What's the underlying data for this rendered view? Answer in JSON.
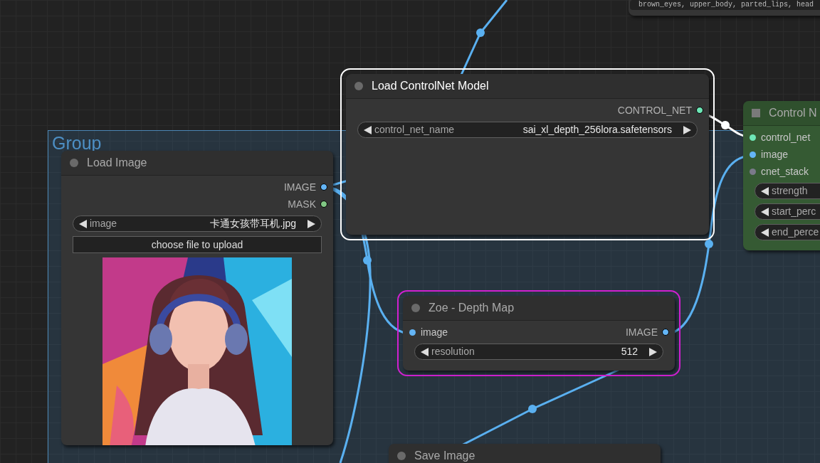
{
  "canvas": {
    "groups": [
      {
        "title": "Group"
      }
    ],
    "nodes": [
      {
        "kind": "note",
        "selected": false,
        "running": false,
        "color": "#353535",
        "widgets": [
          {
            "kind": "text",
            "value": "brown_eyes, upper_body, parted_lips, head"
          }
        ]
      },
      {
        "title": "Load Image",
        "kind": "standard",
        "selected": false,
        "running": false,
        "color": "#353535",
        "outputs": [
          {
            "label": "IMAGE",
            "color": "#64b5f6"
          },
          {
            "label": "MASK",
            "color": "#81c784"
          }
        ],
        "widgets": [
          {
            "kind": "combo",
            "label": "image",
            "value": "卡通女孩带耳机.jpg"
          },
          {
            "kind": "button",
            "label": "choose file to upload"
          },
          {
            "kind": "picture"
          }
        ]
      },
      {
        "title": "Load ControlNet Model",
        "kind": "standard",
        "selected": true,
        "running": false,
        "color": "#353535",
        "outputs": [
          {
            "label": "CONTROL_NET",
            "color": "#6ee7b7"
          }
        ],
        "widgets": [
          {
            "kind": "combo",
            "label": "control_net_name",
            "value": "sai_xl_depth_256lora.safetensors"
          }
        ]
      },
      {
        "title": "Control N",
        "kind": "custom",
        "selected": false,
        "running": false,
        "color": "#355a33",
        "inputs": [
          {
            "label": "control_net",
            "color": "#6ee7b7"
          },
          {
            "label": "image",
            "color": "#64b5f6"
          },
          {
            "label": "cnet_stack",
            "color": "#7a7a8a"
          }
        ],
        "widgets": [
          {
            "kind": "combo",
            "label": "strength"
          },
          {
            "kind": "combo",
            "label": "start_perc"
          },
          {
            "kind": "combo",
            "label": "end_perce"
          }
        ]
      },
      {
        "title": "Zoe - Depth Map",
        "kind": "standard",
        "selected": false,
        "running": true,
        "color": "#353535",
        "inputs": [
          {
            "label": "image",
            "color": "#64b5f6"
          }
        ],
        "outputs": [
          {
            "label": "IMAGE",
            "color": "#64b5f6"
          }
        ],
        "widgets": [
          {
            "kind": "combo",
            "label": "resolution",
            "value": "512"
          }
        ]
      },
      {
        "title": "Save Image",
        "kind": "standard",
        "selected": false,
        "running": false,
        "color": "#353535"
      }
    ]
  }
}
